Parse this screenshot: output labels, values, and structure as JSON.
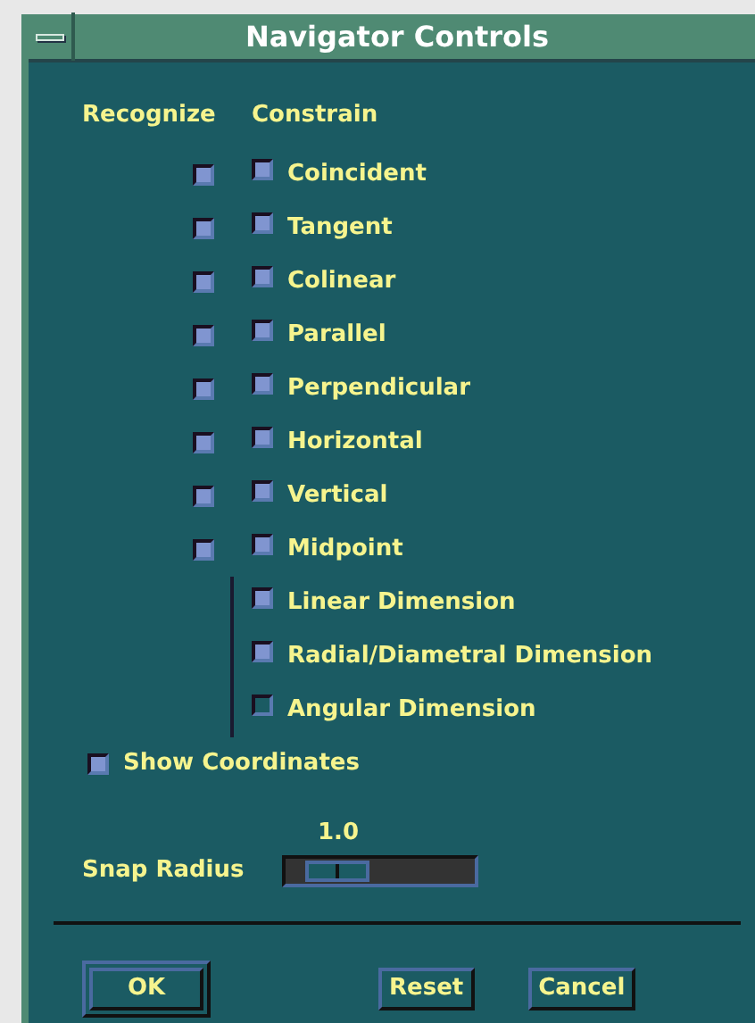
{
  "window": {
    "title": "Navigator Controls"
  },
  "headers": {
    "recognize": "Recognize",
    "constrain": "Constrain"
  },
  "constraints": [
    {
      "kind": "constraint",
      "label": "Coincident",
      "recognize": true,
      "constrain": true
    },
    {
      "kind": "constraint",
      "label": "Tangent",
      "recognize": true,
      "constrain": true
    },
    {
      "kind": "constraint",
      "label": "Colinear",
      "recognize": true,
      "constrain": true
    },
    {
      "kind": "constraint",
      "label": "Parallel",
      "recognize": true,
      "constrain": true
    },
    {
      "kind": "constraint",
      "label": "Perpendicular",
      "recognize": true,
      "constrain": true
    },
    {
      "kind": "constraint",
      "label": "Horizontal",
      "recognize": true,
      "constrain": true
    },
    {
      "kind": "constraint",
      "label": "Vertical",
      "recognize": true,
      "constrain": true
    },
    {
      "kind": "constraint",
      "label": "Midpoint",
      "recognize": true,
      "constrain": true
    },
    {
      "kind": "dimension",
      "label": "Linear Dimension",
      "constrain": true
    },
    {
      "kind": "dimension",
      "label": "Radial/Diametral Dimension",
      "constrain": true
    },
    {
      "kind": "dimension",
      "label": "Angular Dimension",
      "constrain": false
    }
  ],
  "show_coordinates": {
    "label": "Show Coordinates",
    "checked": true
  },
  "snap_radius": {
    "label": "Snap Radius",
    "reading": "1.0",
    "level": 0.15
  },
  "buttons": [
    {
      "label": "OK",
      "default": true
    },
    {
      "label": "Reset",
      "default": false
    },
    {
      "label": "Cancel",
      "default": false
    }
  ]
}
